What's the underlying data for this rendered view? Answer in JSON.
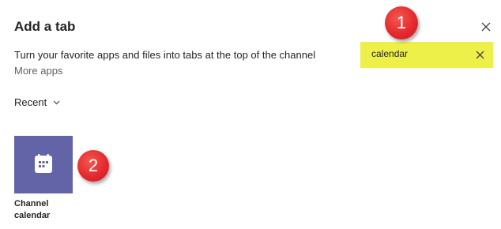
{
  "dialog": {
    "title": "Add a tab",
    "description": "Turn your favorite apps and files into tabs at the top of the channel",
    "more_apps": "More apps",
    "close_icon": "close-icon"
  },
  "search": {
    "value": "calendar",
    "highlight_color": "#eef04a",
    "clear_icon": "close-icon"
  },
  "filter": {
    "label": "Recent",
    "icon": "chevron-down-icon"
  },
  "apps": [
    {
      "name": "Channel\ncalendar",
      "icon": "calendar-icon",
      "tile_color": "#6264a7"
    }
  ],
  "annotations": {
    "marker_1": "1",
    "marker_2": "2",
    "color": "#e3262c"
  }
}
